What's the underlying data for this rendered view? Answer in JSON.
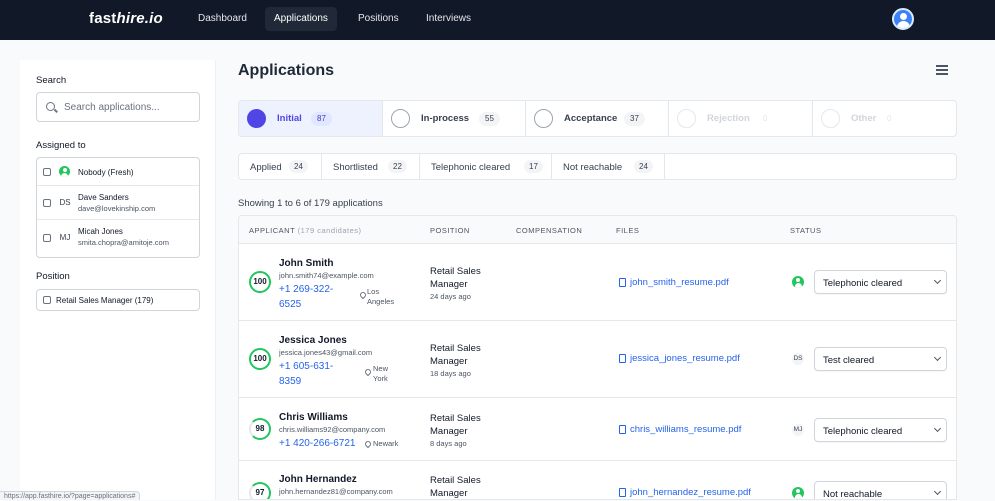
{
  "brand": {
    "fast": "fast",
    "hire": "hire.io"
  },
  "nav": {
    "items": [
      {
        "label": "Dashboard",
        "active": false
      },
      {
        "label": "Applications",
        "active": true
      },
      {
        "label": "Positions",
        "active": false
      },
      {
        "label": "Interviews",
        "active": false
      }
    ]
  },
  "sidebar": {
    "search_label": "Search",
    "search_placeholder": "Search applications...",
    "assigned_label": "Assigned to",
    "assignees": [
      {
        "initials": "",
        "name": "Nobody (Fresh)",
        "email": "",
        "icon": "user-icon"
      },
      {
        "initials": "DS",
        "name": "Dave Sanders",
        "email": "dave@lovekinship.com"
      },
      {
        "initials": "MJ",
        "name": "Micah Jones",
        "email": "smita.chopra@amitoje.com"
      }
    ],
    "position_label": "Position",
    "positions": [
      {
        "label": "Retail Sales Manager (179)"
      }
    ]
  },
  "main": {
    "title": "Applications",
    "stages": [
      {
        "label": "Initial",
        "count": "87",
        "active": true
      },
      {
        "label": "In-process",
        "count": "55"
      },
      {
        "label": "Acceptance",
        "count": "37"
      },
      {
        "label": "Rejection",
        "count": "0",
        "muted": true
      },
      {
        "label": "Other",
        "count": "0",
        "muted": true
      }
    ],
    "substages": [
      {
        "label": "Applied",
        "count": "24"
      },
      {
        "label": "Shortlisted",
        "count": "22"
      },
      {
        "label": "Telephonic cleared",
        "count": "17"
      },
      {
        "label": "Not reachable",
        "count": "24"
      }
    ],
    "showing": "Showing 1 to 6 of 179 applications",
    "table": {
      "headers": {
        "applicant": "Applicant",
        "applicant_sub": "(179 candidates)",
        "position": "Position",
        "compensation": "Compensation",
        "files": "Files",
        "status": "Status"
      },
      "rows": [
        {
          "score": "100",
          "name": "John Smith",
          "email": "john.smith74@example.com",
          "phone": "+1 269-322-6525",
          "location": "Los Angeles",
          "position": "Retail Sales Manager",
          "age": "24 days ago",
          "file": "john_smith_resume.pdf",
          "assignee": "",
          "status": "Telephonic cleared"
        },
        {
          "score": "100",
          "name": "Jessica Jones",
          "email": "jessica.jones43@gmail.com",
          "phone": "+1 605-631-8359",
          "location": "New York",
          "position": "Retail Sales Manager",
          "age": "18 days ago",
          "file": "jessica_jones_resume.pdf",
          "assignee": "DS",
          "status": "Test cleared"
        },
        {
          "score": "98",
          "name": "Chris Williams",
          "email": "chris.williams92@company.com",
          "phone": "+1 420-266-6721",
          "location": "Newark",
          "position": "Retail Sales Manager",
          "age": "8 days ago",
          "file": "chris_williams_resume.pdf",
          "assignee": "MJ",
          "status": "Telephonic cleared"
        },
        {
          "score": "97",
          "name": "John Hernandez",
          "email": "john.hernandez81@company.com",
          "phone": "",
          "location": "",
          "position": "Retail Sales Manager",
          "age": "",
          "file": "john_hernandez_resume.pdf",
          "assignee": "",
          "status": "Not reachable"
        }
      ]
    }
  },
  "status_url": "https://app.fasthire.io/?page=applications#",
  "colors": {
    "navbar": "#111827",
    "accent": "#4f46e5",
    "link": "#2563eb",
    "score_ring": "#22c55e"
  }
}
